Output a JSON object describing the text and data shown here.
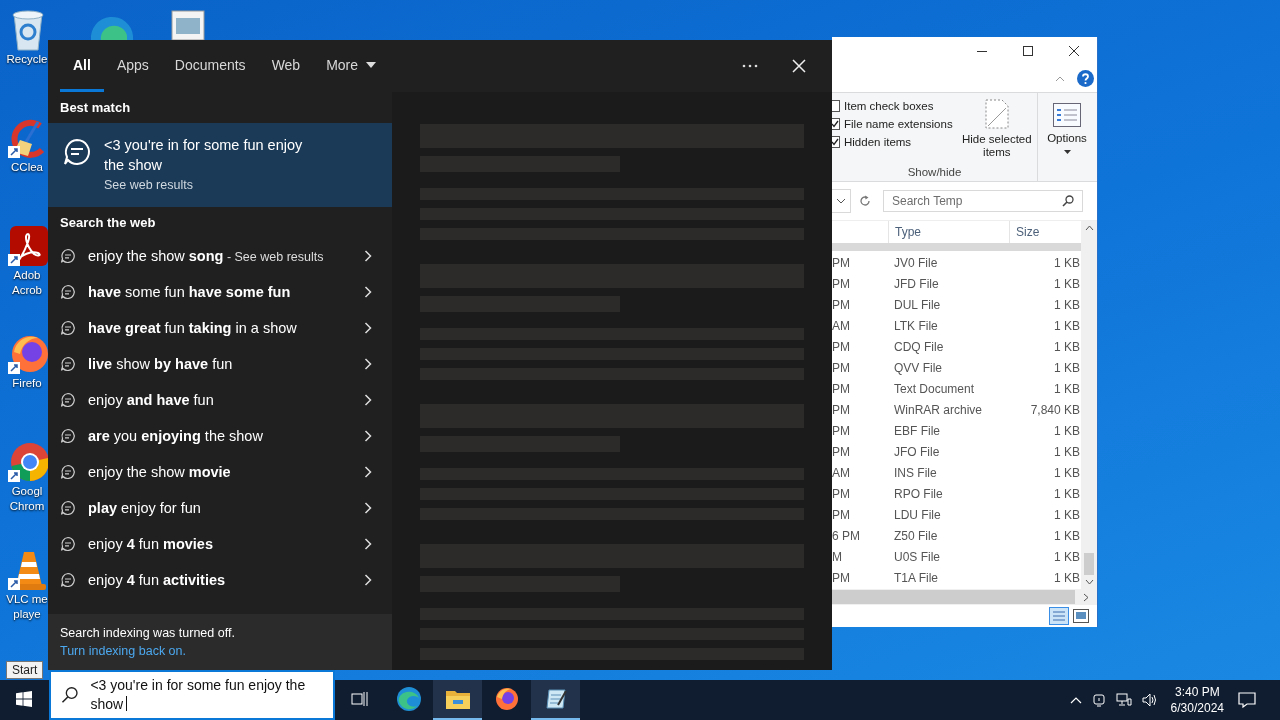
{
  "desktop_icons": [
    {
      "kind": "recycle",
      "lines": [
        "Recycle"
      ]
    },
    {
      "kind": "ccleaner",
      "lines": [
        "CClea"
      ]
    },
    {
      "kind": "acrobat",
      "lines": [
        "Adob",
        "Acrob"
      ]
    },
    {
      "kind": "firefox",
      "lines": [
        "Firefo"
      ]
    },
    {
      "kind": "chrome",
      "lines": [
        "Googl",
        "Chrom"
      ]
    },
    {
      "kind": "vlc",
      "lines": [
        "VLC me",
        "playe"
      ]
    }
  ],
  "explorer": {
    "ribbon_options": [
      {
        "label": "Item check boxes",
        "checked": false
      },
      {
        "label": "File name extensions",
        "checked": true
      },
      {
        "label": "Hidden items",
        "checked": true
      }
    ],
    "hide_button": "Hide selected items",
    "options_button": "Options",
    "group_label": "Show/hide",
    "search_placeholder": "Search Temp",
    "columns": [
      "Type",
      "Size"
    ],
    "rows": [
      {
        "date": "PM",
        "type": "JV0 File",
        "size": "1 KB"
      },
      {
        "date": "PM",
        "type": "JFD File",
        "size": "1 KB"
      },
      {
        "date": "PM",
        "type": "DUL File",
        "size": "1 KB"
      },
      {
        "date": "AM",
        "type": "LTK File",
        "size": "1 KB"
      },
      {
        "date": "PM",
        "type": "CDQ File",
        "size": "1 KB"
      },
      {
        "date": "PM",
        "type": "QVV File",
        "size": "1 KB"
      },
      {
        "date": "PM",
        "type": "Text Document",
        "size": "1 KB"
      },
      {
        "date": "PM",
        "type": "WinRAR archive",
        "size": "7,840 KB"
      },
      {
        "date": "PM",
        "type": "EBF File",
        "size": "1 KB"
      },
      {
        "date": "PM",
        "type": "JFO File",
        "size": "1 KB"
      },
      {
        "date": "AM",
        "type": "INS File",
        "size": "1 KB"
      },
      {
        "date": "PM",
        "type": "RPO File",
        "size": "1 KB"
      },
      {
        "date": "PM",
        "type": "LDU File",
        "size": "1 KB"
      },
      {
        "date": "6 PM",
        "type": "Z50 File",
        "size": "1 KB"
      },
      {
        "date": "M",
        "type": "U0S File",
        "size": "1 KB"
      },
      {
        "date": "PM",
        "type": "T1A File",
        "size": "1 KB"
      }
    ]
  },
  "search": {
    "tabs": [
      {
        "label": "All",
        "selected": true,
        "dropdown": false
      },
      {
        "label": "Apps",
        "selected": false,
        "dropdown": false
      },
      {
        "label": "Documents",
        "selected": false,
        "dropdown": false
      },
      {
        "label": "Web",
        "selected": false,
        "dropdown": false
      },
      {
        "label": "More",
        "selected": false,
        "dropdown": true
      }
    ],
    "best_match_heading": "Best match",
    "best_match": {
      "title": "<3 you're in for some fun enjoy the show",
      "subtitle": "See web results"
    },
    "web_heading": "Search the web",
    "suggestions": [
      {
        "text": "enjoy the show **song**",
        "hint": " - See web results"
      },
      {
        "text": "**have** some fun **have some fun**"
      },
      {
        "text": "**have great** fun **taking** in a show"
      },
      {
        "text": "**live** show **by have** fun"
      },
      {
        "text": "enjoy **and have** fun"
      },
      {
        "text": "**are** you **enjoying** the show"
      },
      {
        "text": "enjoy the show **movie**"
      },
      {
        "text": "**play** enjoy for fun"
      },
      {
        "text": "enjoy **4** fun **movies**"
      },
      {
        "text": "enjoy **4** fun **activities**"
      }
    ],
    "footer": {
      "message": "Search indexing was turned off.",
      "link": "Turn indexing back on."
    }
  },
  "start_tooltip": "Start",
  "taskbar": {
    "search_value": "<3 you're in for some fun enjoy the show",
    "apps": [
      {
        "kind": "edge",
        "active": false
      },
      {
        "kind": "explorer",
        "active": true
      },
      {
        "kind": "firefox",
        "active": false
      },
      {
        "kind": "notepad",
        "active": true
      }
    ],
    "clock_time": "3:40 PM",
    "clock_date": "6/30/2024"
  }
}
